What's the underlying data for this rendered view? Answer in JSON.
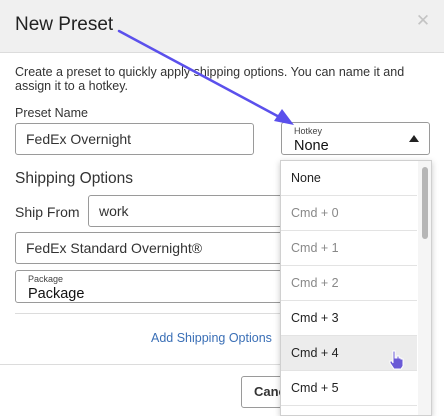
{
  "modal": {
    "title": "New Preset",
    "close_icon": "close-icon",
    "description": "Create a preset to quickly apply shipping options. You can name it and assign it to a hotkey."
  },
  "form": {
    "preset_name_label": "Preset Name",
    "preset_name_value": "FedEx Overnight",
    "hotkey_label": "Hotkey",
    "hotkey_value": "None",
    "shipping_options_title": "Shipping Options",
    "ship_from_label": "Ship From",
    "ship_from_value": "work",
    "service_value": "FedEx Standard Overnight®",
    "package_label": "Package",
    "package_value": "Package",
    "add_shipping_options_link": "Add Shipping Options"
  },
  "footer": {
    "cancel_label": "Cancel"
  },
  "hotkey_dropdown": {
    "options": [
      "None",
      "Cmd + 0",
      "Cmd + 1",
      "Cmd + 2",
      "Cmd + 3",
      "Cmd + 4",
      "Cmd + 5"
    ],
    "hovered_option": "Cmd + 4"
  },
  "colors": {
    "arrow": "#5b50ec",
    "link": "#3a6fb6",
    "header_bg": "#f0f0f0",
    "cursor_fill": "#6a5ad6"
  },
  "icons": {
    "close": "close-icon",
    "caret": "caret-up-icon",
    "cursor": "hand-pointer-icon",
    "annotation": "annotation-arrow-icon"
  }
}
